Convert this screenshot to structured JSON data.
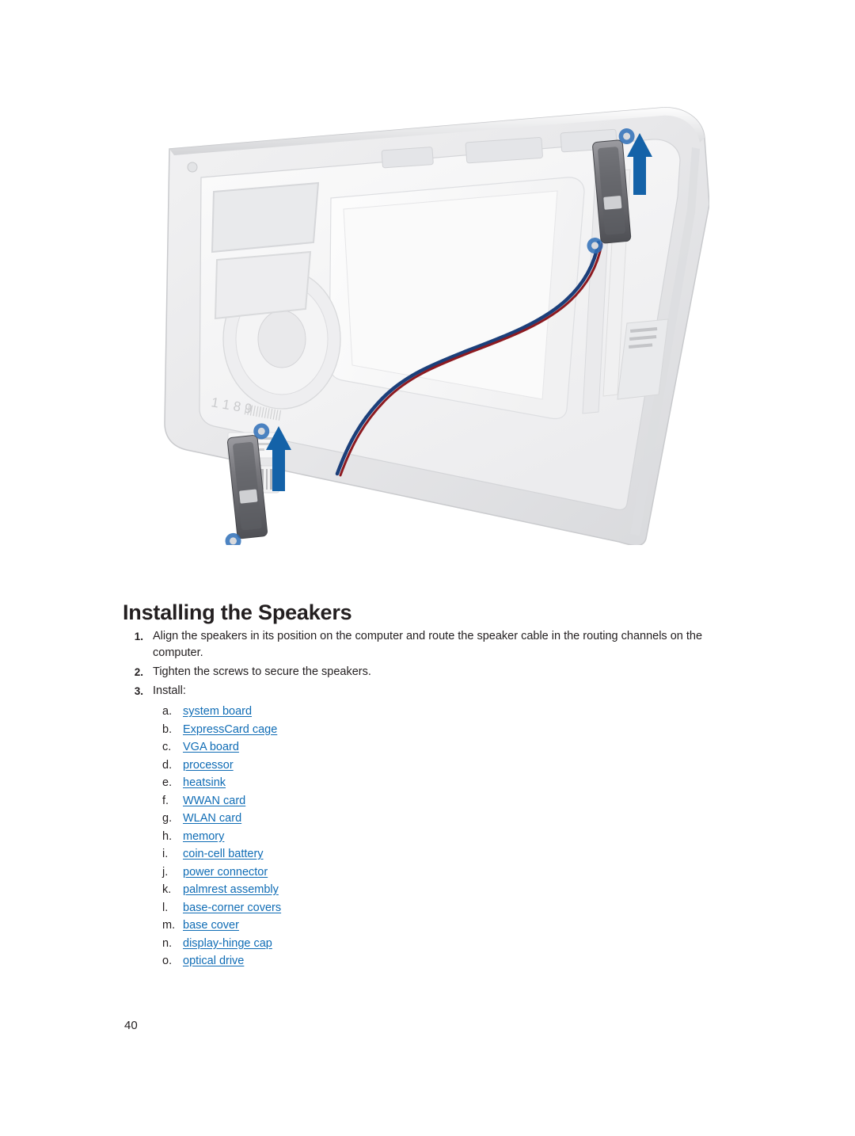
{
  "document": {
    "heading": "Installing the Speakers",
    "page_number": "40",
    "figure": {
      "name": "speaker-installation-diagram",
      "description": "Laptop base chassis with two speakers and routed speaker cable, blue arrows indicating speaker placement"
    },
    "steps": [
      {
        "number": "1.",
        "text": "Align the speakers in its position on the computer and route the speaker cable in the routing channels on the computer."
      },
      {
        "number": "2.",
        "text": "Tighten the screws to secure the speakers."
      },
      {
        "number": "3.",
        "text": "Install:"
      }
    ],
    "install_items": [
      {
        "marker": "a.",
        "label": "system board"
      },
      {
        "marker": "b.",
        "label": "ExpressCard cage"
      },
      {
        "marker": "c.",
        "label": "VGA board"
      },
      {
        "marker": "d.",
        "label": "processor"
      },
      {
        "marker": "e.",
        "label": "heatsink"
      },
      {
        "marker": "f.",
        "label": "WWAN card"
      },
      {
        "marker": "g.",
        "label": "WLAN card"
      },
      {
        "marker": "h.",
        "label": "memory"
      },
      {
        "marker": "i.",
        "label": "coin-cell battery"
      },
      {
        "marker": "j.",
        "label": "power connector"
      },
      {
        "marker": "k.",
        "label": "palmrest assembly"
      },
      {
        "marker": "l.",
        "label": "base-corner covers"
      },
      {
        "marker": "m.",
        "label": "base cover"
      },
      {
        "marker": "n.",
        "label": "display-hinge cap"
      },
      {
        "marker": "o.",
        "label": "optical drive"
      }
    ],
    "colors": {
      "link": "#0f6cb5",
      "text": "#231f20"
    }
  }
}
